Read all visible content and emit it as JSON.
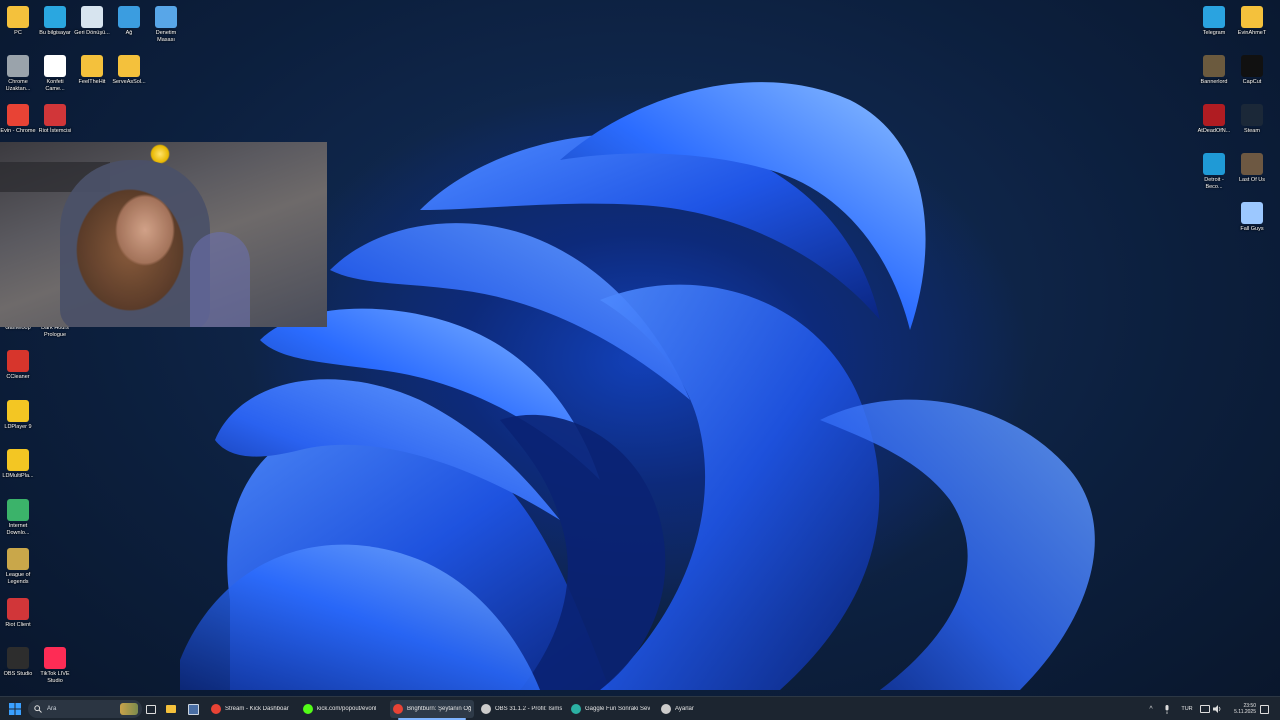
{
  "desktop_icons_left": [
    {
      "label": "PC",
      "icon": "folder-icon",
      "color": "#f4c13c"
    },
    {
      "label": "Bu bilgisayar",
      "icon": "monitor-icon",
      "color": "#2aa7e0"
    },
    {
      "label": "Geri Dönüşü...",
      "icon": "recycle-bin-icon",
      "color": "#d7e4ef"
    },
    {
      "label": "Ağ",
      "icon": "network-icon",
      "color": "#3b9de0"
    },
    {
      "label": "Denetim Masası",
      "icon": "control-panel-icon",
      "color": "#58a6e8"
    },
    {
      "label": "Chrome Uzaktan...",
      "icon": "chrome-remote-icon",
      "color": "#9aa3ab"
    },
    {
      "label": "Konfeti Came...",
      "icon": "document-icon",
      "color": "#ffffff"
    },
    {
      "label": "FeelTheHit",
      "icon": "folder-icon",
      "color": "#f4c13c"
    },
    {
      "label": "ServeAsSol...",
      "icon": "folder-icon",
      "color": "#f4c13c"
    },
    {
      "label": "Evin - Chrome",
      "icon": "chrome-icon",
      "color": "#e84335"
    },
    {
      "label": "Riot İstemcisi",
      "icon": "riot-icon",
      "color": "#d13639"
    },
    {
      "label": "Gameloop",
      "icon": "gameloop-icon",
      "color": "#3a86ff"
    },
    {
      "label": "Dark Hours Prologue",
      "icon": "game-icon",
      "color": "#444444"
    },
    {
      "label": "CCleaner",
      "icon": "ccleaner-icon",
      "color": "#d7352c"
    },
    {
      "label": "LDPlayer 9",
      "icon": "ldplayer-icon",
      "color": "#f3c623"
    },
    {
      "label": "LDMultiPla...",
      "icon": "ldmulti-icon",
      "color": "#f3c623"
    },
    {
      "label": "Internet Downlo...",
      "icon": "idm-icon",
      "color": "#3bb36a"
    },
    {
      "label": "League of Legends",
      "icon": "lol-icon",
      "color": "#c9a74a"
    },
    {
      "label": "Riot Client",
      "icon": "riot-icon",
      "color": "#d13639"
    },
    {
      "label": "OBS Studio",
      "icon": "obs-icon",
      "color": "#2d2d2d"
    },
    {
      "label": "TikTok LIVE Studio",
      "icon": "tiktok-icon",
      "color": "#fe2c55"
    }
  ],
  "desktop_icons_right": [
    {
      "label": "Telegram",
      "icon": "telegram-icon",
      "color": "#2aa3e0"
    },
    {
      "label": "EvinAhmeT",
      "icon": "folder-icon",
      "color": "#f4c13c"
    },
    {
      "label": "Bannerlord",
      "icon": "bannerlord-icon",
      "color": "#6b5a3e"
    },
    {
      "label": "CapCut",
      "icon": "capcut-icon",
      "color": "#111111"
    },
    {
      "label": "AtDeadOfN...",
      "icon": "game-icon",
      "color": "#b01c22"
    },
    {
      "label": "Steam",
      "icon": "steam-icon",
      "color": "#1b2838"
    },
    {
      "label": "Detroit - Beco...",
      "icon": "detroit-icon",
      "color": "#1f9ad6"
    },
    {
      "label": "Last Of Us",
      "icon": "game-icon",
      "color": "#6d5842"
    },
    {
      "label": "Fall Guys",
      "icon": "fallguys-icon",
      "color": "#9cc8ff"
    }
  ],
  "taskbar": {
    "search_placeholder": "Ara",
    "apps": [
      {
        "label": "Stream - Kick Dashboar",
        "icon": "chrome-icon",
        "color": "#e84335"
      },
      {
        "label": "kick.com/popout/evonl",
        "icon": "kick-icon",
        "color": "#53fc18"
      },
      {
        "label": "Brightburn: Şeytanın Oğ",
        "icon": "chrome-icon",
        "color": "#e84335"
      },
      {
        "label": "OBS 31.1.2 - Profil: İsims",
        "icon": "obs-icon",
        "color": "#cccccc"
      },
      {
        "label": "Gaggle Fun Sonraki Sev",
        "icon": "edge-icon",
        "color": "#2bb1a4"
      },
      {
        "label": "Ayarlar",
        "icon": "gear-icon",
        "color": "#cccccc"
      }
    ],
    "language": "TUR",
    "time": "23:50",
    "date": "5.11.2025"
  }
}
